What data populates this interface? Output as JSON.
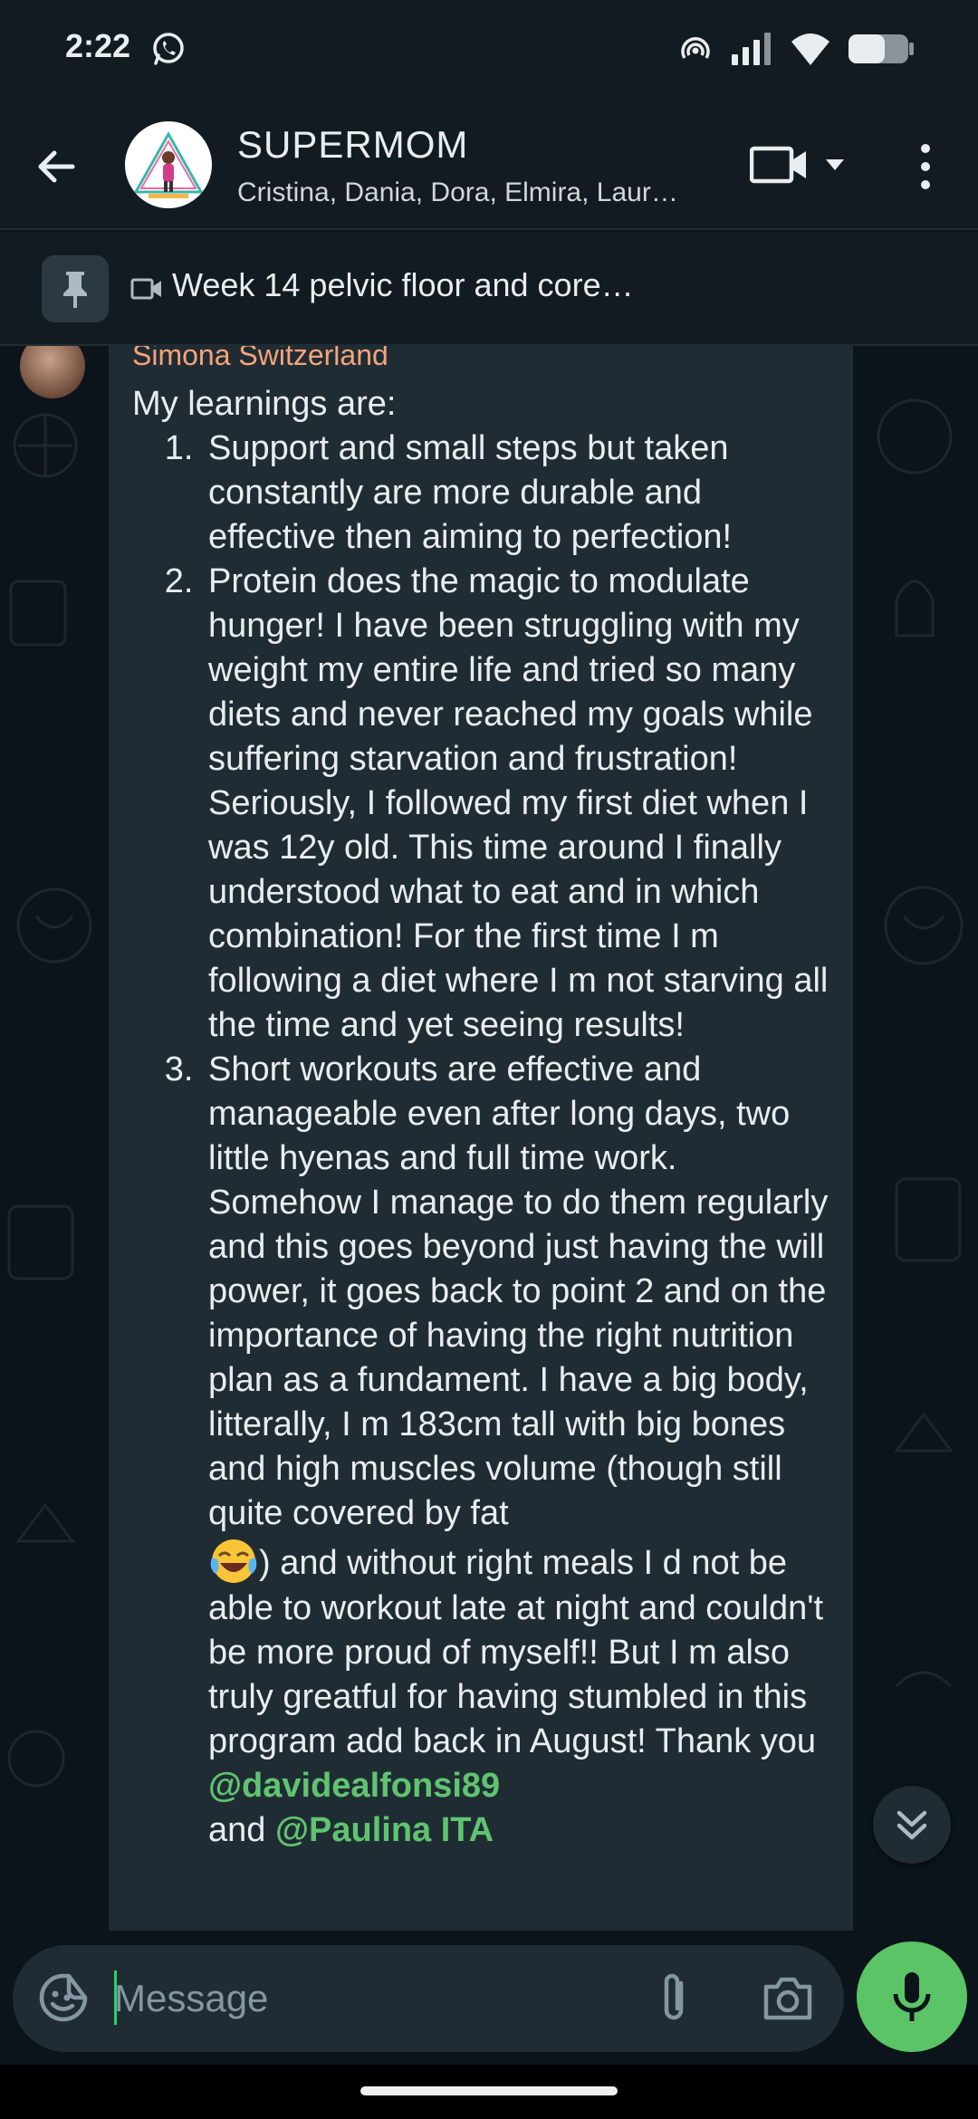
{
  "status_bar": {
    "time": "2:22",
    "icons": [
      "whatsapp-icon",
      "hotspot-icon",
      "signal-icon",
      "wifi-icon",
      "battery-icon"
    ]
  },
  "header": {
    "title": "SUPERMOM",
    "members": "Cristina, Dania, Dora, Elmira, Laur…",
    "icons": [
      "back-arrow-icon",
      "group-avatar",
      "video-call-icon",
      "chevron-down-icon",
      "more-vert-icon"
    ]
  },
  "pinned": {
    "text": "Week 14 pelvic floor and core…",
    "icons": [
      "pin-icon",
      "video-icon"
    ]
  },
  "message": {
    "sender": "Simona Switzerland",
    "intro": "My learnings are:",
    "items": [
      "Support and small steps but taken constantly are more durable and effective then aiming to perfection!",
      "Protein does the magic to modulate hunger! I have been struggling with my weight my entire life and tried so many diets and never reached my goals while suffering starvation and frustration! Seriously, I followed my first diet when I was 12y old. This time around I finally understood what to eat and in which combination! For the first time I m following a diet where I m not starving all the time and yet seeing results!",
      "Short workouts are effective and manageable even after long days, two little hyenas and full time work. Somehow I manage to do them regularly and this goes beyond just having the will power, it goes back to point 2 and on the importance of having the right nutrition plan as a fundament. I have a big body, litterally, I m 183cm tall with big bones and high muscles volume (though still quite covered by fat"
    ],
    "item3_after_emoji": ") and without right meals I d not be able to workout late at night and couldn't be more proud of myself!! But I m also truly greatful for having stumbled in this program add back in August! Thank you ",
    "mention_1": "@davidealfonsi89",
    "after_mention": " and ",
    "mention_2": "@Paulina ITA",
    "emoji": "tears-of-joy-emoji"
  },
  "composer": {
    "placeholder": "Message",
    "icons": [
      "sticker-icon",
      "attach-icon",
      "camera-icon",
      "mic-icon"
    ]
  },
  "colors": {
    "header_bg": "#111b21",
    "chat_bg": "#0b141a",
    "bubble_bg": "#202c33",
    "sender_name": "#f5a47a",
    "mention": "#5fc470",
    "accent_green": "#5ac466"
  }
}
